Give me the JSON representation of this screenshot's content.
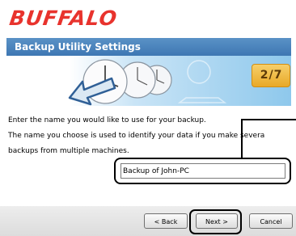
{
  "brand": {
    "logo_text": "BUFFALO",
    "logo_color": "#e8332d"
  },
  "header": {
    "title": "Backup Utility Settings"
  },
  "step": {
    "current": "2",
    "separator": "/",
    "total": "7"
  },
  "instructions": {
    "line1": "Enter the name you would like to use for your backup.",
    "line2": "The name you choose is used to identify your data if you make severa",
    "line3": "backups from multiple machines."
  },
  "backup_name": {
    "value": "Backup of John-PC"
  },
  "footer": {
    "back_label": "< Back",
    "next_label": "Next >",
    "cancel_label": "Cancel"
  },
  "colors": {
    "title_bar": "#3e77b3",
    "step_badge": "#e9a928"
  }
}
